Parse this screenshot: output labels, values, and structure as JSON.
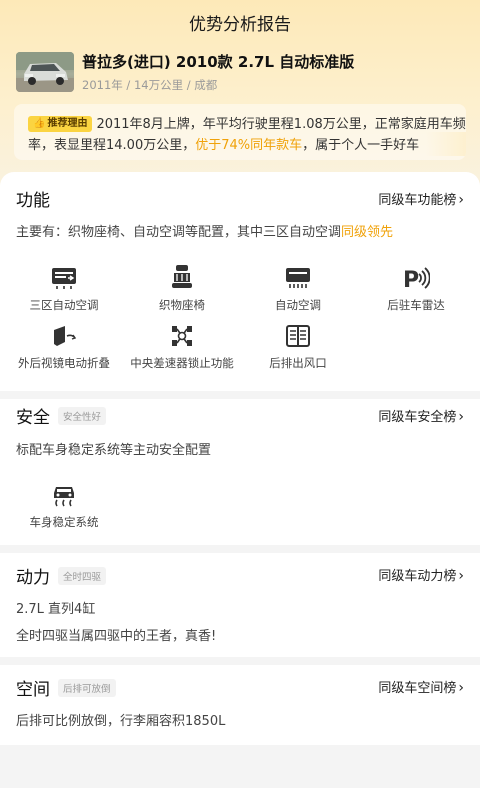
{
  "page_title": "优势分析报告",
  "car": {
    "title": "普拉多(进口) 2010款 2.7L 自动标准版",
    "meta": "2011年 / 14万公里 / 成都"
  },
  "reason": {
    "tag": "推荐理由",
    "text_1": "2011年8月上牌，年平均行驶里程1.08万公里，正常家庭用车频率，表显里程14.00万公里，",
    "highlight": "优于74%同年款车",
    "text_2": "，属于个人一手好车"
  },
  "sections": {
    "function": {
      "title": "功能",
      "rank_link": "同级车功能榜",
      "desc_prefix": "主要有：织物座椅、自动空调等配置，其中三区自动空调",
      "desc_highlight": "同级领先",
      "features": [
        {
          "label": "三区自动空调",
          "icon": "ac-tri-zone-icon"
        },
        {
          "label": "织物座椅",
          "icon": "seat-icon"
        },
        {
          "label": "自动空调",
          "icon": "ac-icon"
        },
        {
          "label": "后驻车雷达",
          "icon": "parking-radar-icon"
        },
        {
          "label": "外后视镜电动折叠",
          "icon": "mirror-fold-icon"
        },
        {
          "label": "中央差速器锁止功能",
          "icon": "diff-lock-icon"
        },
        {
          "label": "后排出风口",
          "icon": "rear-vent-icon"
        }
      ]
    },
    "safety": {
      "title": "安全",
      "tag": "安全性好",
      "rank_link": "同级车安全榜",
      "desc": "标配车身稳定系统等主动安全配置",
      "features": [
        {
          "label": "车身稳定系统",
          "icon": "stability-control-icon"
        }
      ]
    },
    "power": {
      "title": "动力",
      "tag": "全时四驱",
      "rank_link": "同级车动力榜",
      "line_1": "2.7L 直列4缸",
      "line_2": "全时四驱当属四驱中的王者，真香!"
    },
    "space": {
      "title": "空间",
      "tag": "后排可放倒",
      "rank_link": "同级车空间榜",
      "desc": "后排可比例放倒，行李厢容积1850L"
    }
  },
  "colors": {
    "accent": "#f0a20a",
    "tag_bg": "#fbd441",
    "header_bg": "#fde9b8",
    "icon": "#333333"
  }
}
